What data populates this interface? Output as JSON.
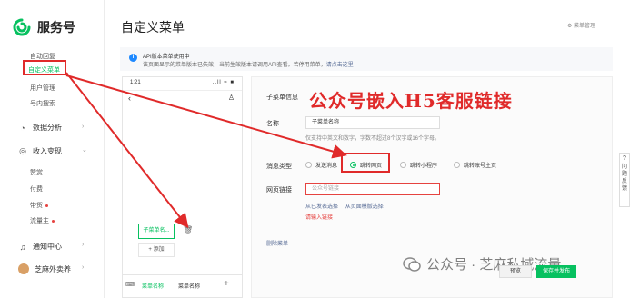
{
  "sidebar": {
    "brand": "服务号",
    "items": [
      {
        "label": "自动回复"
      },
      {
        "label": "自定义菜单",
        "active": true
      },
      {
        "label": "用户管理"
      },
      {
        "label": "号内搜索"
      }
    ],
    "groups": [
      {
        "label": "数据分析",
        "icon": "chart-icon"
      },
      {
        "label": "收入变现",
        "icon": "coin-icon"
      }
    ],
    "sub_items": [
      {
        "label": "赞赏"
      },
      {
        "label": "付费"
      },
      {
        "label": "带货"
      },
      {
        "label": "流量主"
      }
    ],
    "notify": "通知中心",
    "account": "芝麻外卖养"
  },
  "page": {
    "title": "自定义菜单",
    "settings_link": "菜单管理"
  },
  "notice": {
    "line1": "API版本菜单使用中",
    "line2": "该页面显示的菜单版本已失效，当前生效版本请调用API查看。若停用菜单，",
    "link": "请点击这里"
  },
  "phone": {
    "time": "1:21",
    "status": "..ll ≈ ■",
    "submenu": "子菜单名...",
    "add": "+ 添加",
    "tabs": [
      "菜单名称",
      "菜单名称"
    ],
    "plus": "+"
  },
  "editor": {
    "heading": "子菜单信息",
    "name_label": "名称",
    "name_value": "子菜单名称",
    "name_hint": "仅支持中英文和数字，字数不超过8个汉字或16个字母。",
    "type_label": "消息类型",
    "types": [
      "发送消息",
      "跳转网页",
      "跳转小程序",
      "跳转账号主页"
    ],
    "selected_type": "跳转网页",
    "url_label": "网页链接",
    "url_placeholder": "公众号链接",
    "url_links": [
      "从已发表选择",
      "从页面模版选择"
    ],
    "url_error": "请输入链接",
    "delete": "删除菜单"
  },
  "overlay_title": "公众号嵌入H5客服链接",
  "buttons": {
    "preview": "预览",
    "publish": "保存并发布"
  },
  "watermark": "公众号 · 芝麻私域流量",
  "help": {
    "q": "?",
    "text": "问题反馈"
  },
  "colors": {
    "accent": "#07c160",
    "annotation": "#e02a2a",
    "link": "#576b95"
  }
}
